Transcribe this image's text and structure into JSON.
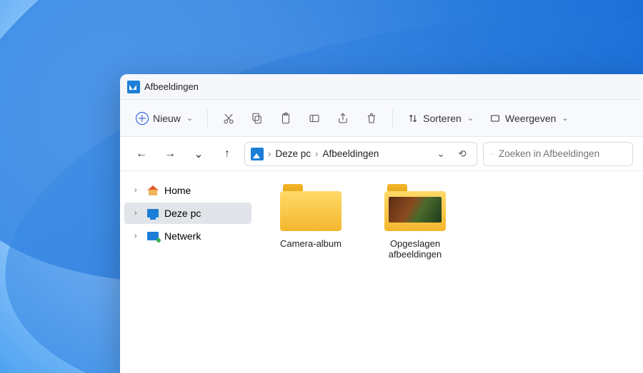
{
  "window": {
    "title": "Afbeeldingen"
  },
  "toolbar": {
    "new_label": "Nieuw",
    "sort_label": "Sorteren",
    "view_label": "Weergeven",
    "icons": {
      "cut": "cut-icon",
      "copy": "copy-icon",
      "paste": "paste-icon",
      "rename": "rename-icon",
      "share": "share-icon",
      "delete": "delete-icon",
      "sort": "sort-icon",
      "view": "view-icon"
    }
  },
  "breadcrumb": {
    "segments": [
      "Deze pc",
      "Afbeeldingen"
    ]
  },
  "search": {
    "placeholder": "Zoeken in Afbeeldingen"
  },
  "sidebar": {
    "items": [
      {
        "label": "Home",
        "kind": "home",
        "selected": false
      },
      {
        "label": "Deze pc",
        "kind": "pc",
        "selected": true
      },
      {
        "label": "Netwerk",
        "kind": "network",
        "selected": false
      }
    ]
  },
  "folders": [
    {
      "label": "Camera-album",
      "has_thumb": false
    },
    {
      "label": "Opgeslagen afbeeldingen",
      "has_thumb": true
    }
  ]
}
